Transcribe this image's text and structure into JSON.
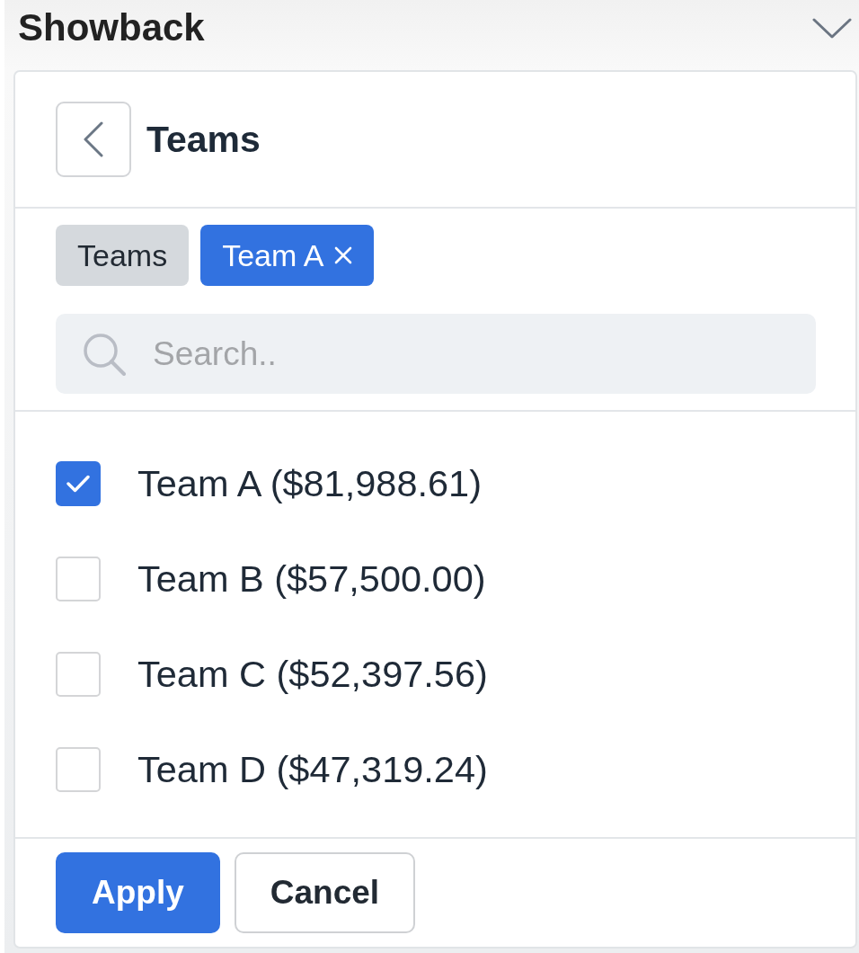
{
  "section": {
    "title": "Showback"
  },
  "panel_header": {
    "title": "Teams"
  },
  "chips": [
    {
      "label": "Teams",
      "kind": "crumb"
    },
    {
      "label": "Team A",
      "kind": "filter"
    }
  ],
  "search": {
    "placeholder": "Search.."
  },
  "options": [
    {
      "label": "Team A ($81,988.61)",
      "checked": true
    },
    {
      "label": "Team B ($57,500.00)",
      "checked": false
    },
    {
      "label": "Team C ($52,397.56)",
      "checked": false
    },
    {
      "label": "Team D ($47,319.24)",
      "checked": false
    }
  ],
  "buttons": [
    {
      "label": "Apply",
      "kind": "primary"
    },
    {
      "label": "Cancel",
      "kind": "secondary"
    }
  ]
}
